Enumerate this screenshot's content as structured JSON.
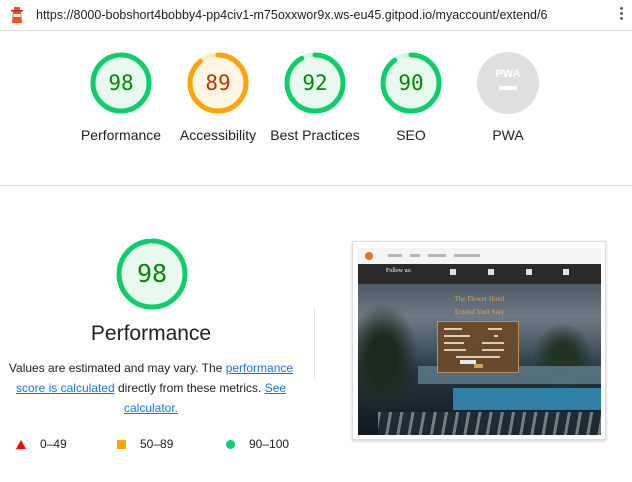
{
  "browser": {
    "url": "https://8000-bobshort4bobby4-pp4civ1-m75oxxwor9x.ws-eu45.gitpod.io/myaccount/extend/6"
  },
  "colors": {
    "pass": "#0cce6b",
    "average": "#ffa400",
    "fail": "#eb0f00",
    "link": "#1a73e8"
  },
  "gauges": [
    {
      "label": "Performance",
      "score": "98",
      "level": 0.98,
      "status": "pass"
    },
    {
      "label": "Accessibility",
      "score": "89",
      "level": 0.89,
      "status": "average"
    },
    {
      "label": "Best Practices",
      "score": "92",
      "level": 0.92,
      "status": "pass"
    },
    {
      "label": "SEO",
      "score": "90",
      "level": 0.9,
      "status": "pass"
    },
    {
      "label": "PWA",
      "badge": "PWA",
      "status": "na"
    }
  ],
  "main": {
    "score": "98",
    "level": 0.98,
    "title": "Performance",
    "desc_prefix": "Values are estimated and may vary. The ",
    "link_score": "performance score is calculated",
    "desc_mid": " directly from these metrics. ",
    "link_calc": "See calculator."
  },
  "legend": {
    "fail": "0–49",
    "average": "50–89",
    "pass": "90–100"
  },
  "screenshot": {
    "follow": "Follow us:",
    "hotel_name": "The Flower Hotel",
    "subtitle": "Extend Your Stay"
  }
}
